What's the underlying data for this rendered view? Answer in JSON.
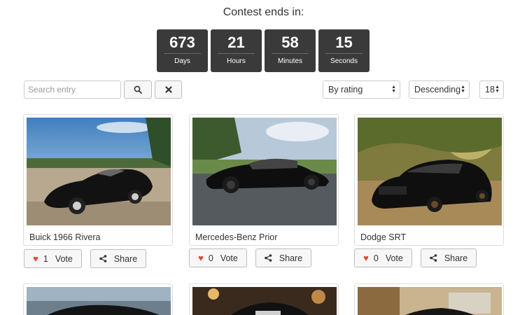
{
  "contest": {
    "title": "Contest ends in:",
    "countdown": [
      {
        "value": "673",
        "label": "Days"
      },
      {
        "value": "21",
        "label": "Hours"
      },
      {
        "value": "58",
        "label": "Minutes"
      },
      {
        "value": "15",
        "label": "Seconds"
      }
    ]
  },
  "toolbar": {
    "search_placeholder": "Search entry",
    "search_icon": "search-icon",
    "clear_icon": "close-icon",
    "sort_by": "By rating",
    "order": "Descending",
    "per_page": "18"
  },
  "entries": [
    {
      "name": "Buick 1966 Rivera",
      "votes": "1",
      "vote_label": "Vote",
      "share_label": "Share"
    },
    {
      "name": "Mercedes-Benz Prior",
      "votes": "0",
      "vote_label": "Vote",
      "share_label": "Share"
    },
    {
      "name": "Dodge SRT",
      "votes": "0",
      "vote_label": "Vote",
      "share_label": "Share"
    }
  ],
  "colors": {
    "countdown_bg": "#3a3a3a",
    "heart": "#e2492f"
  }
}
